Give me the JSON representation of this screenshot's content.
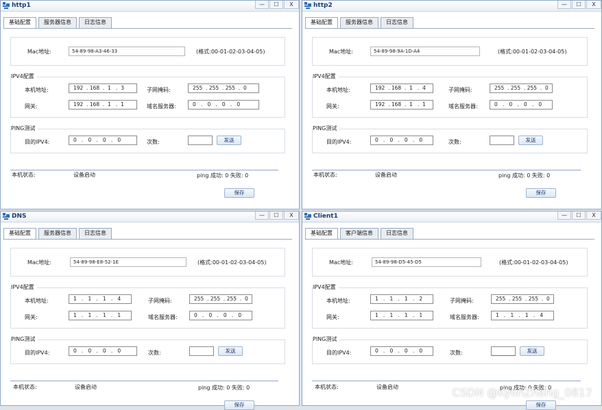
{
  "win_controls": {
    "minimize": "—",
    "maximize": "☐",
    "close": "X"
  },
  "labels": {
    "mac": "Mac地址:",
    "format_hint": "(格式:00-01-02-03-04-05)",
    "ipv4_group": "IPV4配置",
    "local_addr": "本机地址:",
    "subnet": "子网掩码:",
    "gateway": "网关:",
    "dns_server": "域名服务器:",
    "ping_group": "PING测试",
    "dest_ipv4": "目的IPV4:",
    "count": "次数:",
    "send": "发送",
    "local_status": "本机状态:",
    "save": "保存"
  },
  "windows": [
    {
      "title": "http1",
      "tabs": [
        "基础配置",
        "服务器信息",
        "日志信息"
      ],
      "mac": "54-89-98-A3-46-33",
      "ip": "192  . 168  .  1   .  3",
      "mask": "255  . 255  . 255  .  0",
      "gateway": "192  . 168  .  1   .  1",
      "dns": "0   .   0   .   0   .   0",
      "ping_dest": "0   .   0   .   0   .   0",
      "ping_count": "",
      "status": "设备启动",
      "ping_result": "ping 成功: 0 失败: 0"
    },
    {
      "title": "http2",
      "tabs": [
        "基础配置",
        "服务器信息",
        "日志信息"
      ],
      "mac": "54-89-98-9A-1D-A4",
      "ip": "192  . 168  .  1   .  4",
      "mask": "255  . 255  . 255  .  0",
      "gateway": "192  . 168  .  1   .  1",
      "dns": "0   .   0   .   0   .   0",
      "ping_dest": "0   .   0   .   0   .   0",
      "ping_count": "",
      "status": "设备启动",
      "ping_result": "ping 成功: 0 失败: 0"
    },
    {
      "title": "DNS",
      "tabs": [
        "基础配置",
        "服务器信息",
        "日志信息"
      ],
      "mac": "54-89-98-E8-52-1E",
      "ip": "1   .   1   .   1   .   4",
      "mask": "255  . 255  . 255  .  0",
      "gateway": "1   .   1   .   1   .   1",
      "dns": "0   .   0   .   0   .   0",
      "ping_dest": "0   .   0   .   0   .   0",
      "ping_count": "",
      "status": "设备启动",
      "ping_result": "ping 成功: 0 失败: 0"
    },
    {
      "title": "Client1",
      "tabs": [
        "基础配置",
        "客户端信息",
        "日志信息"
      ],
      "mac": "54-89-98-D5-45-D5",
      "ip": "1   .   1   .   1   .   2",
      "mask": "255  . 255  . 255  .  0",
      "gateway": "1   .   1   .   1   .   1",
      "dns": "1   .   1   .   1   .   4",
      "ping_dest": "0   .   0   .   0   .   0",
      "ping_count": "",
      "status": "设备启动",
      "ping_result": "ping 成功: 0 失败: 0"
    }
  ],
  "watermark": "CSDN @KylinZhang_0817"
}
